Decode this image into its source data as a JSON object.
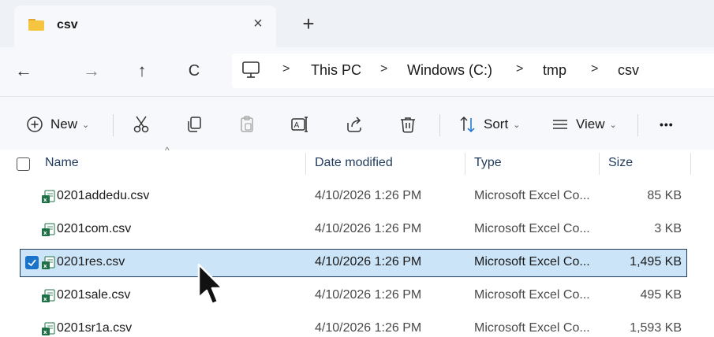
{
  "tab": {
    "title": "csv",
    "close_glyph": "×",
    "new_glyph": "+"
  },
  "nav": {
    "back": "←",
    "forward": "→",
    "up": "↑",
    "refresh": "C"
  },
  "breadcrumbs": [
    "This PC",
    "Windows (C:)",
    "tmp",
    "csv"
  ],
  "breadcrumb_sep": ">",
  "toolbar": {
    "new_label": "New",
    "sort_label": "Sort",
    "view_label": "View",
    "more_label": "•••",
    "caret": "⌄"
  },
  "columns": {
    "name": "Name",
    "date": "Date modified",
    "type": "Type",
    "size": "Size"
  },
  "files": [
    {
      "name": "0201addedu.csv",
      "date": "4/10/2026 1:26 PM",
      "type": "Microsoft Excel Co...",
      "size": "85 KB",
      "selected": false
    },
    {
      "name": "0201com.csv",
      "date": "4/10/2026 1:26 PM",
      "type": "Microsoft Excel Co...",
      "size": "3 KB",
      "selected": false
    },
    {
      "name": "0201res.csv",
      "date": "4/10/2026 1:26 PM",
      "type": "Microsoft Excel Co...",
      "size": "1,495 KB",
      "selected": true
    },
    {
      "name": "0201sale.csv",
      "date": "4/10/2026 1:26 PM",
      "type": "Microsoft Excel Co...",
      "size": "495 KB",
      "selected": false
    },
    {
      "name": "0201sr1a.csv",
      "date": "4/10/2026 1:26 PM",
      "type": "Microsoft Excel Co...",
      "size": "1,593 KB",
      "selected": false
    }
  ],
  "colors": {
    "folder": "#f5c542",
    "excel_green": "#1e7145",
    "selection": "#cce4f7",
    "check": "#1a73c9"
  },
  "icons": [
    "folder-icon",
    "close-icon",
    "plus-icon",
    "back-icon",
    "forward-icon",
    "up-icon",
    "refresh-icon",
    "pc-icon",
    "cut-icon",
    "copy-icon",
    "paste-icon",
    "rename-icon",
    "share-icon",
    "delete-icon",
    "sort-icon",
    "view-icon",
    "excel-csv-icon",
    "mouse-cursor-icon"
  ]
}
